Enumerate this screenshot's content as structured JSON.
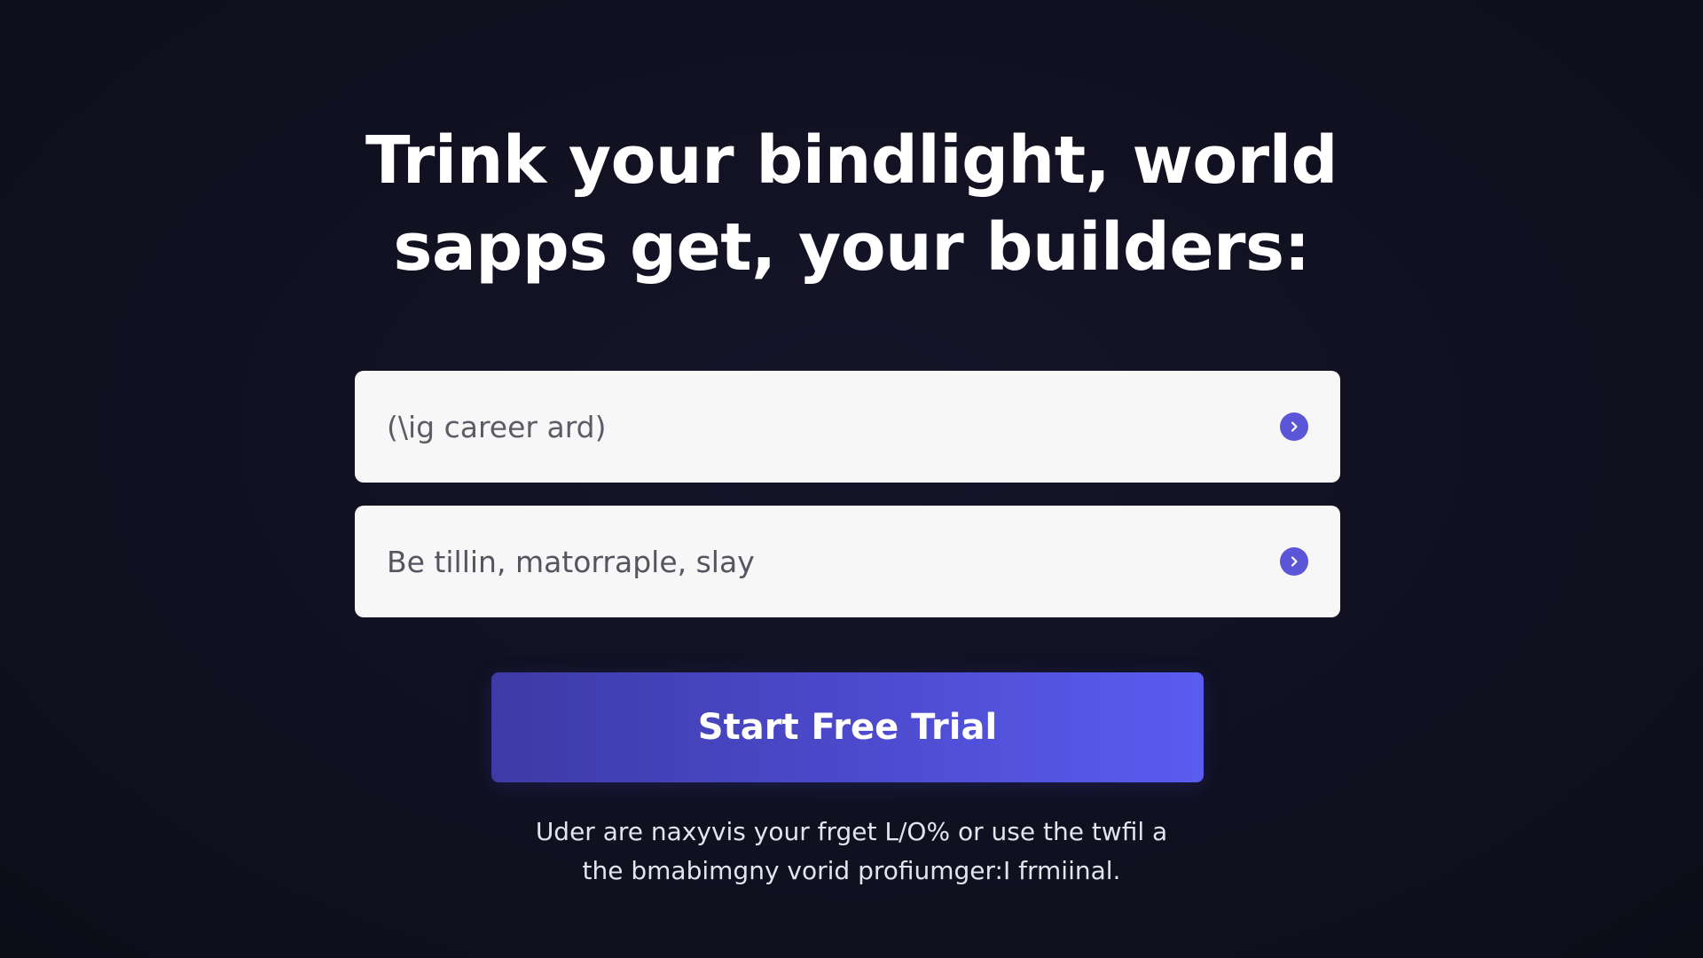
{
  "hero": {
    "headline_line1": "Trink your bindlight, world",
    "headline_line2": "sapps get, your builders:"
  },
  "form": {
    "field1": {
      "placeholder": "(\\ig career ard)",
      "icon": "arrow-right-circle-icon"
    },
    "field2": {
      "placeholder": "Be tillin, matorraple, slay",
      "icon": "arrow-right-circle-icon"
    },
    "submit_label": "Start Free Trial"
  },
  "footnote": {
    "line1": "Uder are naxyvis your frget L/O% or use the twfil a",
    "line2": "the bmabimgny vorid profiumger:I frmiinal."
  },
  "colors": {
    "background": "#111122",
    "field_background": "#f7f7f8",
    "accent": "#5b56d8",
    "button_gradient_start": "#3e3aa6",
    "button_gradient_end": "#5a5cf0",
    "text_primary": "#ffffff",
    "text_secondary": "#e4e4ee"
  }
}
